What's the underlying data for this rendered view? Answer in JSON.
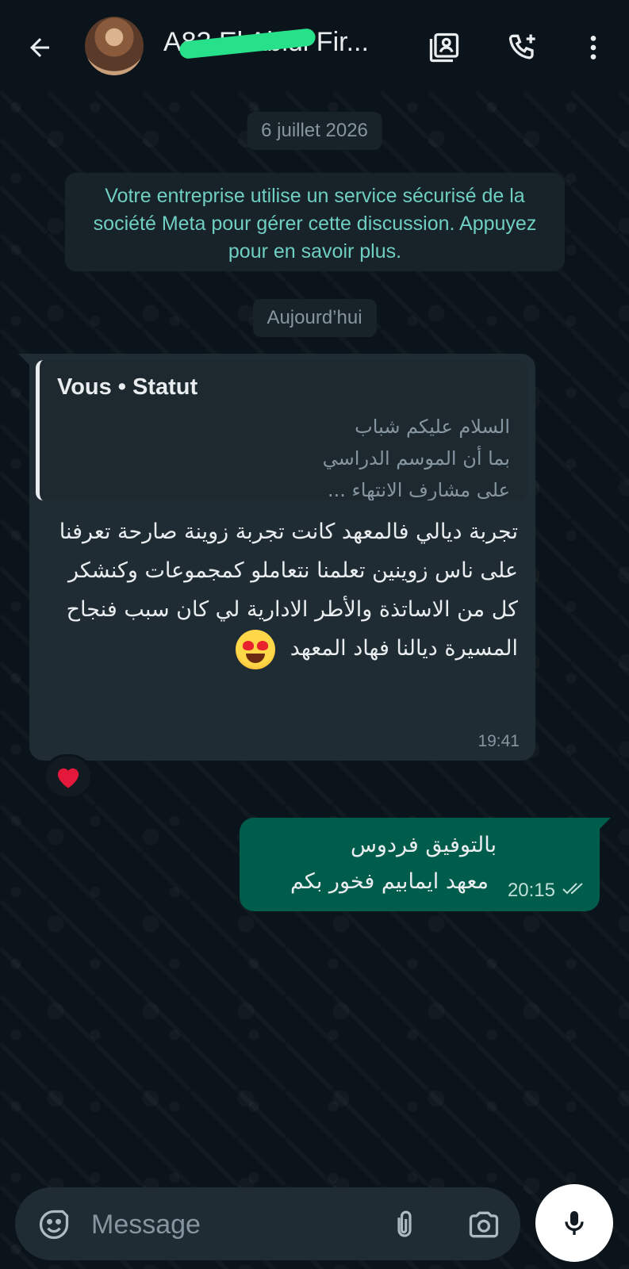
{
  "header": {
    "contact_name": "A83 El Abidi Fir...",
    "icons": [
      "back-arrow-icon",
      "contact-card-icon",
      "add-call-icon",
      "more-vert-icon"
    ]
  },
  "chat": {
    "date_chip": "6 juillet 2026",
    "system_notice": "Votre entreprise utilise un service sécurisé de la société Meta pour gérer cette discussion. Appuyez pour en savoir plus.",
    "today_chip": "Aujourd’hui",
    "incoming": {
      "quote_title": "Vous • Statut",
      "quote_lines": [
        "السلام عليكم شباب",
        "بما أن الموسم الدراسي",
        "على مشارف الانتهاء ..."
      ],
      "text": "تجربة ديالي فالمعهد كانت تجربة زوينة صارحة تعرفنا على ناس زوينين تعلمنا نتعاملو كمجموعات وكنشكر كل من الاساتذة والأطر الادارية لي كان سبب فنجاح المسيرة ديالنا فهاد المعهد",
      "emoji": "heart-eyes-emoji",
      "time": "19:41",
      "reaction": "❤"
    },
    "outgoing": {
      "line1": "بالتوفيق فردوس",
      "line2": "معهد ايمابيم فخور بكم",
      "time": "20:15",
      "status_icon": "double-check-icon"
    }
  },
  "input_bar": {
    "placeholder": "Message",
    "icons": [
      "sticker-icon",
      "attach-icon",
      "camera-icon",
      "mic-icon"
    ]
  },
  "colors": {
    "background": "#0b141a",
    "incoming_bubble": "#202c33",
    "outgoing_bubble": "#005c4b",
    "notice_text": "#6fcfc2",
    "redaction": "#27e08a"
  }
}
